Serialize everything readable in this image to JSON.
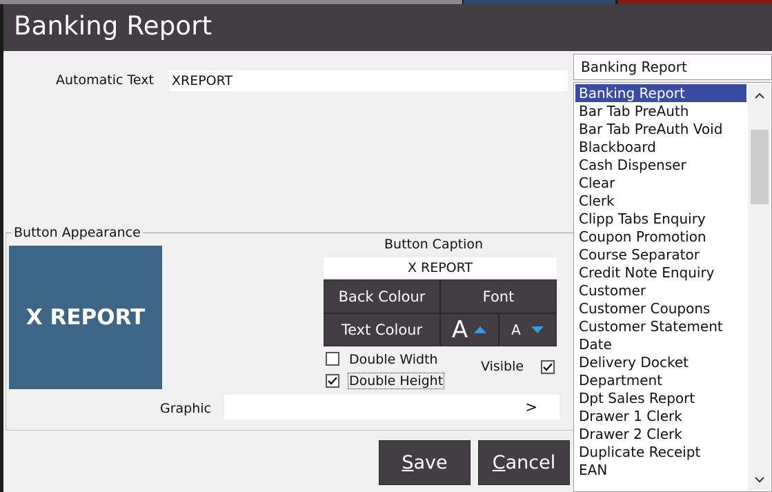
{
  "window": {
    "title": "Banking Report"
  },
  "automatic_text": {
    "label": "Automatic Text",
    "value": "XREPORT"
  },
  "button_appearance": {
    "legend": "Button Appearance",
    "preview_text": "X REPORT",
    "caption_label": "Button Caption",
    "caption_value": "X REPORT",
    "back_colour_label": "Back Colour",
    "font_label": "Font",
    "text_colour_label": "Text Colour",
    "font_increase_glyph": "A",
    "font_decrease_glyph": "A",
    "double_width": {
      "label": "Double Width",
      "checked": false
    },
    "double_height": {
      "label": "Double Height",
      "checked": true
    },
    "visible": {
      "label": "Visible",
      "checked": true
    },
    "graphic_label": "Graphic",
    "graphic_value": "",
    "graphic_browse": ">"
  },
  "footer": {
    "save_label_first": "S",
    "save_label_rest": "ave",
    "cancel_label_first": "C",
    "cancel_label_rest": "ancel"
  },
  "function_list": {
    "search_value": "Banking Report",
    "selected": "Banking Report",
    "items": [
      "Banking Report",
      "Bar Tab PreAuth",
      "Bar Tab PreAuth Void",
      "Blackboard",
      "Cash Dispenser",
      "Clear",
      "Clerk",
      "Clipp Tabs Enquiry",
      "Coupon Promotion",
      "Course Separator",
      "Credit Note Enquiry",
      "Customer",
      "Customer Coupons",
      "Customer Statement",
      "Date",
      "Delivery Docket",
      "Department",
      "Dpt Sales Report",
      "Drawer 1 Clerk",
      "Drawer 2 Clerk",
      "Duplicate Receipt",
      "EAN"
    ]
  },
  "colors": {
    "titlebar": "#423d42",
    "button_preview": "#3f6586",
    "selection": "#3b4ba0",
    "arrow_accent": "#3a9be0"
  }
}
